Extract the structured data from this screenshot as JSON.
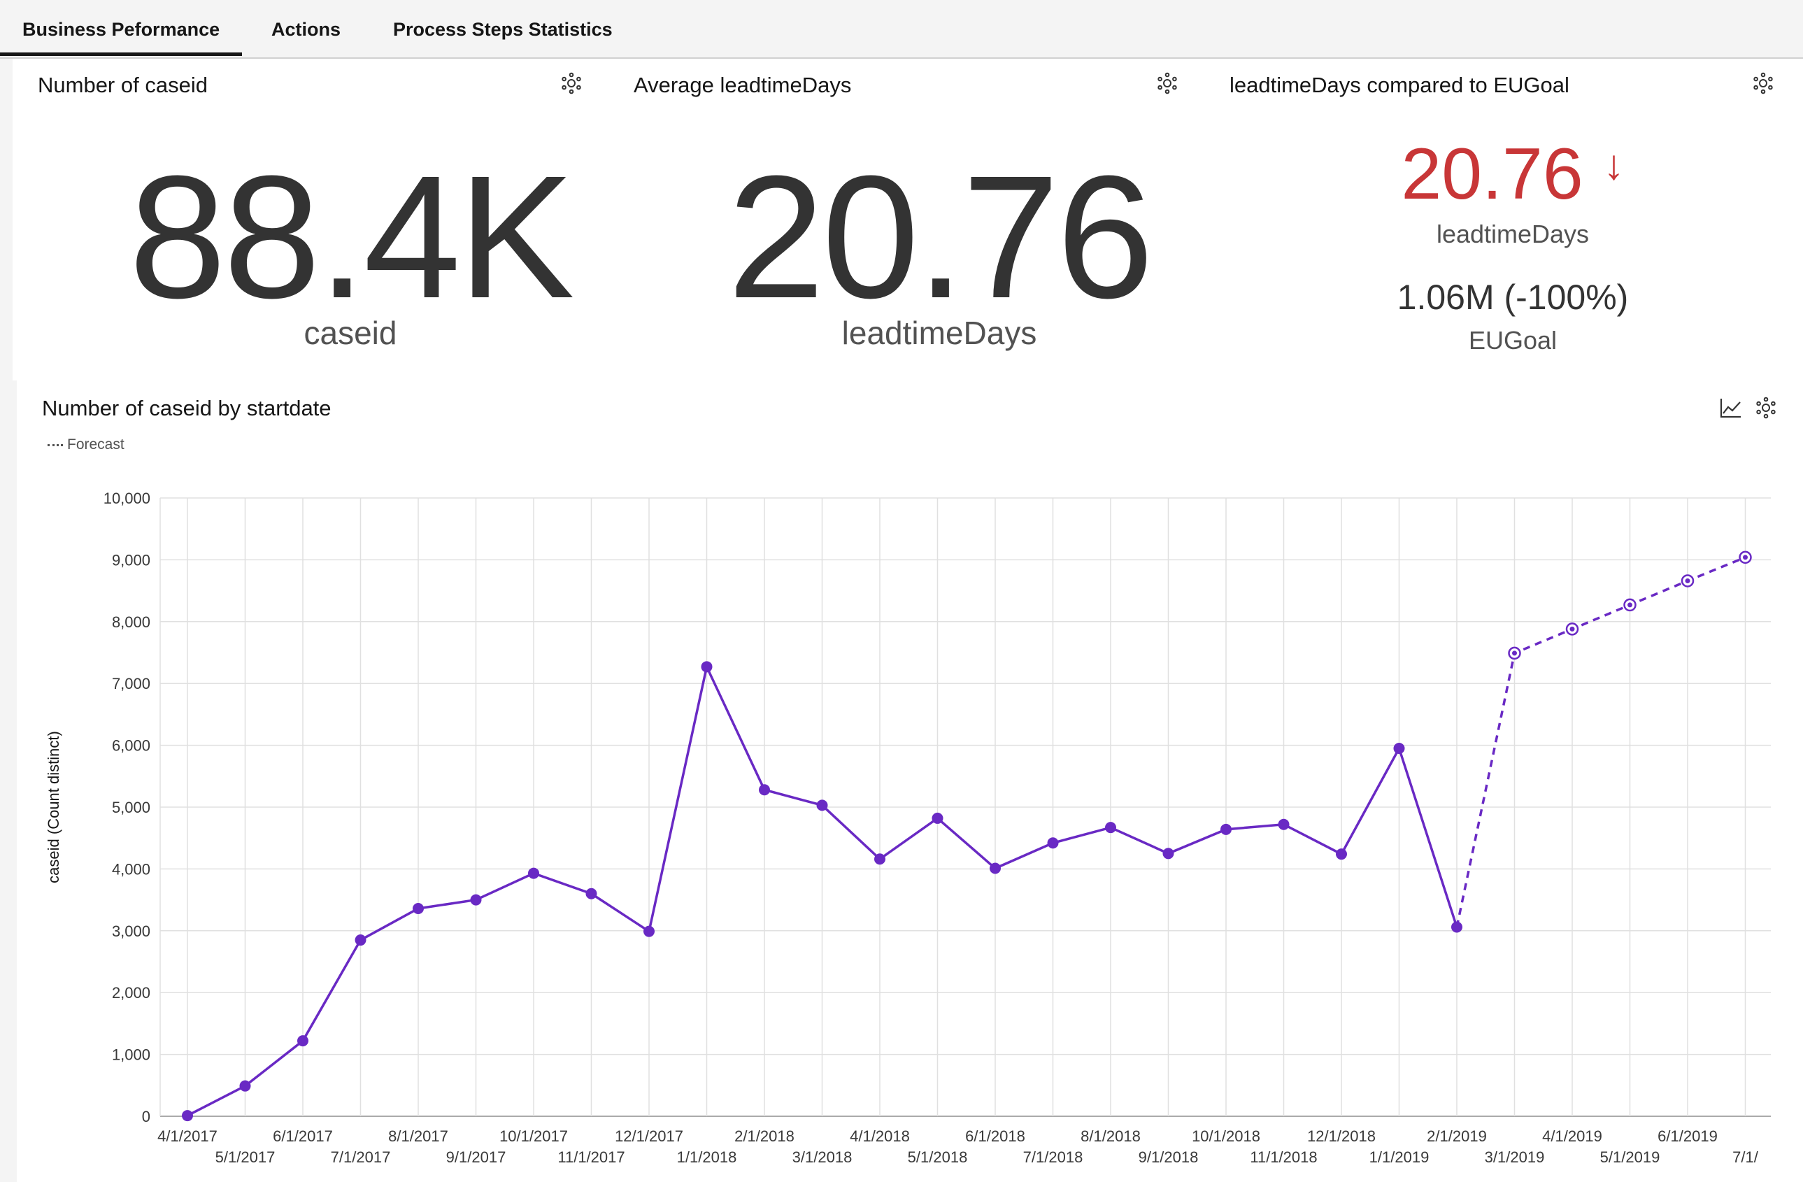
{
  "tabs": [
    {
      "label": "Business Peformance",
      "active": true
    },
    {
      "label": "Actions",
      "active": false
    },
    {
      "label": "Process Steps Statistics",
      "active": false
    }
  ],
  "kpis": {
    "count_title": "Number of caseid",
    "count_value": "88.4K",
    "count_unit": "caseid",
    "avg_title": "Average leadtimeDays",
    "avg_value": "20.76",
    "avg_unit": "leadtimeDays",
    "compare_title": "leadtimeDays compared to EUGoal",
    "compare_value": "20.76",
    "compare_arrow": "↓",
    "compare_unit": "leadtimeDays",
    "goal_value": "1.06M (-100%)",
    "goal_label": "EUGoal",
    "compare_color": "#c83637"
  },
  "chart_title": "Number of caseid by startdate",
  "legend_label": "Forecast",
  "chart_data": {
    "type": "line",
    "title": "Number of caseid by startdate",
    "xlabel": "",
    "ylabel": "caseid (Count distinct)",
    "ylim": [
      0,
      10000
    ],
    "yticks": [
      0,
      1000,
      2000,
      3000,
      4000,
      5000,
      6000,
      7000,
      8000,
      9000,
      10000
    ],
    "ytick_labels": [
      "0",
      "1,000",
      "2,000",
      "3,000",
      "4,000",
      "5,000",
      "6,000",
      "7,000",
      "8,000",
      "9,000",
      "10,000"
    ],
    "categories": [
      "4/1/2017",
      "5/1/2017",
      "6/1/2017",
      "7/1/2017",
      "8/1/2017",
      "9/1/2017",
      "10/1/2017",
      "11/1/2017",
      "12/1/2017",
      "1/1/2018",
      "2/1/2018",
      "3/1/2018",
      "4/1/2018",
      "5/1/2018",
      "6/1/2018",
      "7/1/2018",
      "8/1/2018",
      "9/1/2018",
      "10/1/2018",
      "11/1/2018",
      "12/1/2018",
      "1/1/2019",
      "2/1/2019",
      "3/1/2019",
      "4/1/2019",
      "5/1/2019",
      "6/1/2019",
      "7/1/2019"
    ],
    "xtick_labels": [
      "4/1/2017",
      "5/1/2017",
      "6/1/2017",
      "7/1/2017",
      "8/1/2017",
      "9/1/2017",
      "10/1/2017",
      "11/1/2017",
      "12/1/2017",
      "1/1/2018",
      "2/1/2018",
      "3/1/2018",
      "4/1/2018",
      "5/1/2018",
      "6/1/2018",
      "7/1/2018",
      "8/1/2018",
      "9/1/2018",
      "10/1/2018",
      "11/1/2018",
      "12/1/2018",
      "1/1/2019",
      "2/1/2019",
      "3/1/2019",
      "4/1/2019",
      "5/1/2019",
      "6/1/2019",
      "7/1/"
    ],
    "series": [
      {
        "values": [
          10,
          490,
          1220,
          2850,
          3360,
          3500,
          3930,
          3600,
          2990,
          7270,
          5280,
          5030,
          4160,
          4820,
          4010,
          4420,
          4670,
          4250,
          4640,
          4720,
          4240,
          5950,
          3060,
          null,
          null,
          null,
          null,
          null
        ],
        "color": "#6929c4"
      },
      {
        "name": "Forecast",
        "values": [
          null,
          null,
          null,
          null,
          null,
          null,
          null,
          null,
          null,
          null,
          null,
          null,
          null,
          null,
          null,
          null,
          null,
          null,
          null,
          null,
          null,
          null,
          3060,
          7490,
          7880,
          8270,
          8660,
          9040
        ],
        "color": "#6929c4",
        "dashed": true
      }
    ],
    "grid": true
  }
}
